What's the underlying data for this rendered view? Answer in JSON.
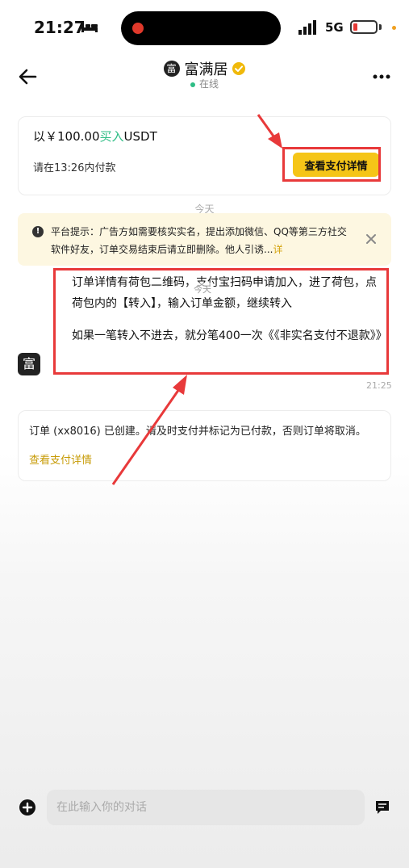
{
  "status_bar": {
    "time": "21:27",
    "network": "5G"
  },
  "header": {
    "avatar_char": "富",
    "name": "富满居",
    "status": "在线"
  },
  "order_card": {
    "prefix": "以￥100.00",
    "action": "买入",
    "asset": "USDT",
    "pay_note": "请在13:26内付款",
    "button_label": "查看支付详情"
  },
  "divider_label": "今天",
  "warning": {
    "text": "平台提示：广告方如需要核实实名，提出添加微信、QQ等第三方社交软件好友，订单交易结束后请立即删除。他人引诱...",
    "more": "详"
  },
  "message": {
    "para1": "订单详情有荷包二维码，支付宝扫码申请加入，进了荷包，点荷包内的【转入】，输入订单金额，继续转入",
    "para2": "如果一笔转入不进去，就分笔400一次《《非实名支付不退款》》",
    "overlay_label": "今天",
    "avatar_char": "富",
    "time": "21:25"
  },
  "created_card": {
    "text": "订单 (xx8016) 已创建。请及时支付并标记为已付款，否则订单将取消。",
    "link": "查看支付详情"
  },
  "input_bar": {
    "placeholder": "在此输入你的对话"
  },
  "colors": {
    "accent": "#f5c518",
    "buy": "#2ebd85",
    "annotation": "#e8393a"
  }
}
